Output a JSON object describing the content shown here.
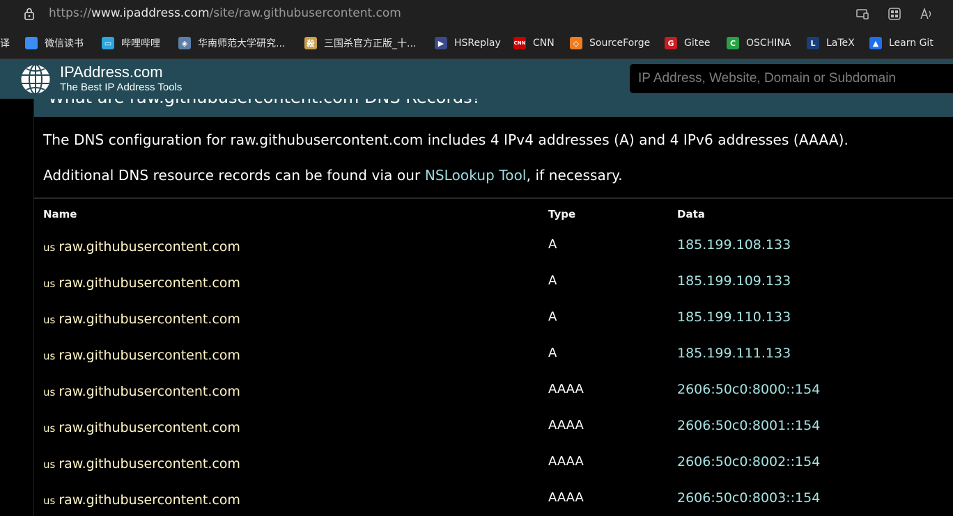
{
  "browser": {
    "url_prefix": "https://",
    "url_host": "www.ipaddress.com",
    "url_path": "/site/raw.githubusercontent.com",
    "icons": [
      "lock-icon",
      "cast-icon",
      "apps-icon",
      "read-aloud-icon"
    ]
  },
  "bookmarks": [
    {
      "label": "译",
      "icon": "translate-icon",
      "color": "#2a2a2a",
      "glyph": ""
    },
    {
      "label": "微信读书",
      "icon": "weread-icon",
      "color": "#3b8cf5",
      "glyph": ""
    },
    {
      "label": "哔哩哔哩",
      "icon": "bilibili-icon",
      "color": "#2aa6e0",
      "glyph": "▭"
    },
    {
      "label": "华南师范大学研究...",
      "icon": "scnu-icon",
      "color": "#5b7fa8",
      "glyph": "◈"
    },
    {
      "label": "三国杀官方正版_十...",
      "icon": "sanguosha-icon",
      "color": "#c8a050",
      "glyph": "殺"
    },
    {
      "label": "HSReplay",
      "icon": "hsreplay-icon",
      "color": "#3a4a8a",
      "glyph": "▶"
    },
    {
      "label": "CNN",
      "icon": "cnn-icon",
      "color": "#cc0000",
      "glyph": "CNN"
    },
    {
      "label": "SourceForge",
      "icon": "sourceforge-icon",
      "color": "#f07c1f",
      "glyph": "◇"
    },
    {
      "label": "Gitee",
      "icon": "gitee-icon",
      "color": "#c71d23",
      "glyph": "G"
    },
    {
      "label": "OSCHINA",
      "icon": "oschina-icon",
      "color": "#27a346",
      "glyph": "C"
    },
    {
      "label": "LaTeX",
      "icon": "latex-icon",
      "color": "#1a3e7a",
      "glyph": "L"
    },
    {
      "label": "Learn Git",
      "icon": "learngit-icon",
      "color": "#1f6feb",
      "glyph": "▲"
    }
  ],
  "site": {
    "brand_name": "IPAddress.com",
    "brand_tagline": "The Best IP Address Tools",
    "search_placeholder": "IP Address, Website, Domain or Subdomain"
  },
  "section": {
    "heading": "What are raw.githubusercontent.com DNS Records?",
    "para1": "The DNS configuration for raw.githubusercontent.com includes 4 IPv4 addresses (A) and 4 IPv6 addresses (AAAA).",
    "para2_before": "Additional DNS resource records can be found via our ",
    "para2_link": "NSLookup Tool",
    "para2_after": ", if necessary."
  },
  "table": {
    "headers": {
      "name": "Name",
      "type": "Type",
      "data": "Data"
    },
    "rows": [
      {
        "country": "us",
        "name": "raw.githubusercontent.com",
        "type": "A",
        "data": "185.199.108.133"
      },
      {
        "country": "us",
        "name": "raw.githubusercontent.com",
        "type": "A",
        "data": "185.199.109.133"
      },
      {
        "country": "us",
        "name": "raw.githubusercontent.com",
        "type": "A",
        "data": "185.199.110.133"
      },
      {
        "country": "us",
        "name": "raw.githubusercontent.com",
        "type": "A",
        "data": "185.199.111.133"
      },
      {
        "country": "us",
        "name": "raw.githubusercontent.com",
        "type": "AAAA",
        "data": "2606:50c0:8000::154"
      },
      {
        "country": "us",
        "name": "raw.githubusercontent.com",
        "type": "AAAA",
        "data": "2606:50c0:8001::154"
      },
      {
        "country": "us",
        "name": "raw.githubusercontent.com",
        "type": "AAAA",
        "data": "2606:50c0:8002::154"
      },
      {
        "country": "us",
        "name": "raw.githubusercontent.com",
        "type": "AAAA",
        "data": "2606:50c0:8003::154"
      }
    ]
  }
}
